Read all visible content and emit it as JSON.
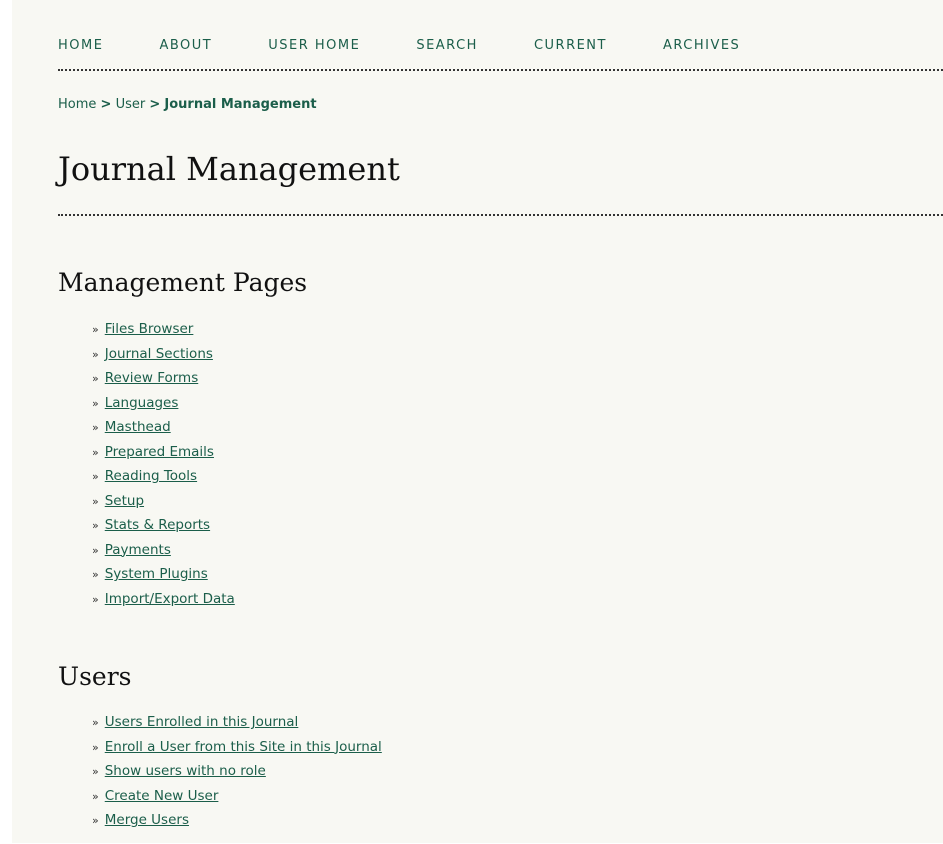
{
  "nav": {
    "items": [
      {
        "label": "HOME"
      },
      {
        "label": "ABOUT"
      },
      {
        "label": "USER HOME"
      },
      {
        "label": "SEARCH"
      },
      {
        "label": "CURRENT"
      },
      {
        "label": "ARCHIVES"
      }
    ]
  },
  "breadcrumb": {
    "home": "Home",
    "user": "User",
    "current": "Journal Management",
    "separator": ">"
  },
  "page_title": "Journal Management",
  "management": {
    "heading": "Management Pages",
    "links": [
      {
        "label": "Files Browser"
      },
      {
        "label": "Journal Sections"
      },
      {
        "label": "Review Forms"
      },
      {
        "label": "Languages"
      },
      {
        "label": "Masthead"
      },
      {
        "label": "Prepared Emails"
      },
      {
        "label": "Reading Tools"
      },
      {
        "label": "Setup"
      },
      {
        "label": "Stats & Reports"
      },
      {
        "label": "Payments"
      },
      {
        "label": "System Plugins"
      },
      {
        "label": "Import/Export Data"
      }
    ]
  },
  "users": {
    "heading": "Users",
    "links": [
      {
        "label": "Users Enrolled in this Journal"
      },
      {
        "label": "Enroll a User from this Site in this Journal"
      },
      {
        "label": "Show users with no role"
      },
      {
        "label": "Create New User"
      },
      {
        "label": "Merge Users"
      }
    ]
  },
  "bullet_glyph": "»",
  "colors": {
    "link": "#1b5e4a",
    "background": "#f8f8f3",
    "heading": "#111111"
  }
}
